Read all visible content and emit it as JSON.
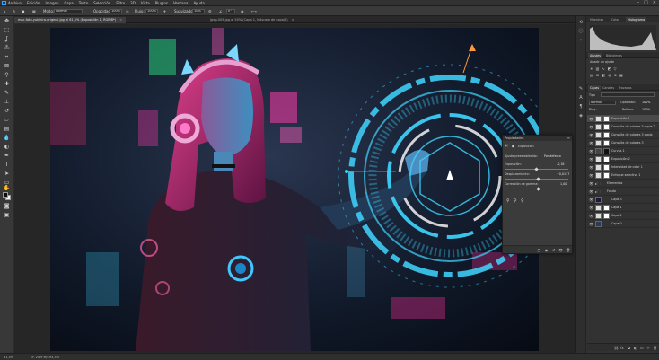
{
  "menubar": {
    "items": [
      "Archivo",
      "Edición",
      "Imagen",
      "Capa",
      "Texto",
      "Selección",
      "Filtro",
      "3D",
      "Vista",
      "Plugins",
      "Ventana",
      "Ayuda"
    ]
  },
  "options": {
    "mode_label": "Modo:",
    "mode_value": "Normal",
    "opacity_label": "Opacidad:",
    "opacity_value": "100%",
    "flow_label": "Flujo:",
    "flow_value": "100%",
    "smoothing_label": "Suavizado:",
    "smoothing_value": "10%",
    "angle_value": "0°"
  },
  "tabs": [
    {
      "label": "mac-foto-yukihiro-original.jpg al 61,5% (Exposición 1, RGB/8*)",
      "active": true
    },
    {
      "label": "jpeg-005.jpg al 50% (Capa 1, Máscara de capa/8)",
      "active": false
    }
  ],
  "properties": {
    "title": "Propiedades",
    "section": "Exposición",
    "preset_label": "Ajuste preestablecido:",
    "preset_value": "Por defecto",
    "exposure_label": "Exposición:",
    "exposure_value": "-0,18",
    "offset_label": "Desplazamiento:",
    "offset_value": "+0,0137",
    "gamma_label": "Corrección de gamma:",
    "gamma_value": "1,00"
  },
  "histogram_panel": {
    "tabs": [
      "Muestras",
      "Color",
      "Histograma"
    ]
  },
  "adjustments_panel": {
    "tabs": [
      "Ajustes",
      "Bibliotecas"
    ],
    "subtitle": "Añadir un ajuste"
  },
  "layers_panel": {
    "tabs": [
      "Capas",
      "Canales",
      "Trazados"
    ],
    "kind_label": "Tipo",
    "blend_mode": "Normal",
    "opacity_label": "Opacidad:",
    "opacity_value": "100%",
    "fill_label": "Relleno:",
    "fill_value": "100%",
    "lock_label": "Bloq.:",
    "layers": [
      {
        "name": "Exposición 1",
        "selected": true,
        "kind": "adj"
      },
      {
        "name": "Consulta de colores 3 copia 2",
        "selected": false,
        "kind": "adj"
      },
      {
        "name": "Consulta de colores 3 copia",
        "selected": false,
        "kind": "adj"
      },
      {
        "name": "Consulta de colores 3",
        "selected": false,
        "kind": "adj"
      },
      {
        "name": "Curvas 1",
        "selected": false,
        "kind": "adj-dark"
      },
      {
        "name": "Exposición 2",
        "selected": false,
        "kind": "adj"
      },
      {
        "name": "Intensidad de color 1",
        "selected": false,
        "kind": "adj"
      },
      {
        "name": "Enfoque selectivo 1",
        "selected": false,
        "kind": "adj"
      },
      {
        "name": "Elementos",
        "selected": false,
        "kind": "group"
      },
      {
        "name": "Fondo",
        "selected": false,
        "kind": "group"
      },
      {
        "name": "Capa 3",
        "selected": false,
        "kind": "img-dark"
      },
      {
        "name": "Capa 1",
        "selected": false,
        "kind": "img"
      },
      {
        "name": "Capa 2",
        "selected": false,
        "kind": "img"
      },
      {
        "name": "Capa 0",
        "selected": false,
        "kind": "img-bg"
      }
    ]
  },
  "status": {
    "zoom": "61,5%",
    "doc": "Ef: 24,9 M/193,5M"
  }
}
